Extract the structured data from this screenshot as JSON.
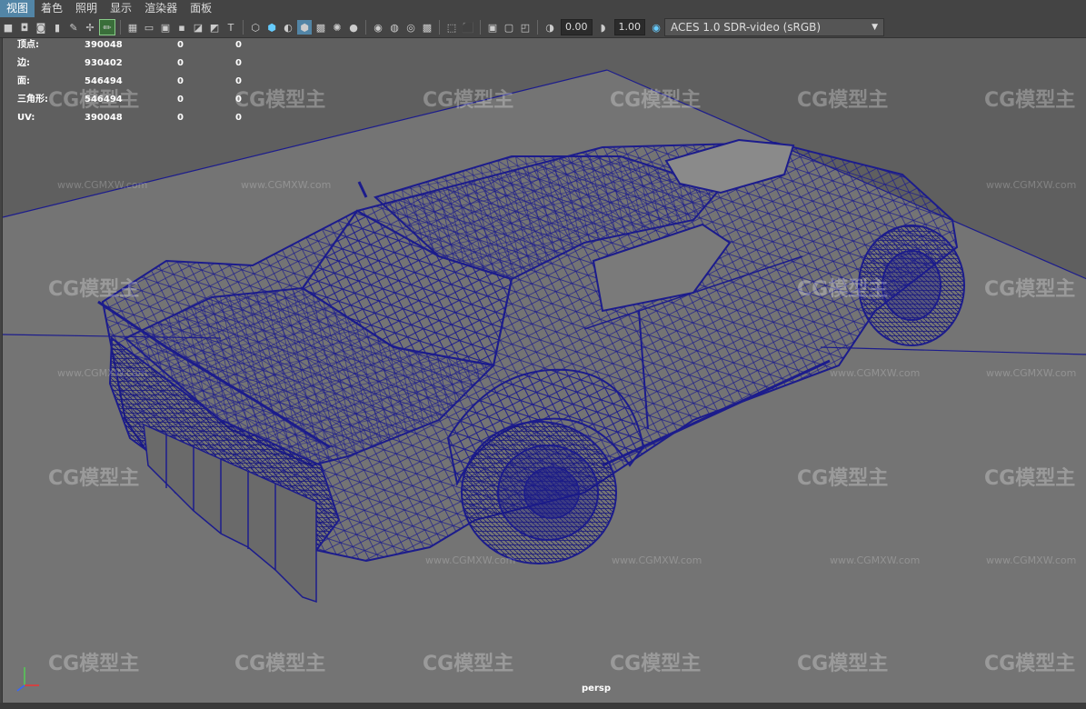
{
  "menu": {
    "items": [
      {
        "label": "视图",
        "active": true
      },
      {
        "label": "着色",
        "active": false
      },
      {
        "label": "照明",
        "active": false
      },
      {
        "label": "显示",
        "active": false
      },
      {
        "label": "渲染器",
        "active": false
      },
      {
        "label": "面板",
        "active": false
      }
    ]
  },
  "toolbar": {
    "exposure_value": "0.00",
    "gamma_value": "1.00",
    "color_space": "ACES 1.0 SDR-video (sRGB)"
  },
  "hud": {
    "rows": [
      {
        "label": "顶点:",
        "value": "390048",
        "sel": "0",
        "comp": "0"
      },
      {
        "label": "边:",
        "value": "930402",
        "sel": "0",
        "comp": "0"
      },
      {
        "label": "面:",
        "value": "546494",
        "sel": "0",
        "comp": "0"
      },
      {
        "label": "三角形:",
        "value": "546494",
        "sel": "0",
        "comp": "0"
      },
      {
        "label": "UV:",
        "value": "390048",
        "sel": "0",
        "comp": "0"
      }
    ]
  },
  "viewport": {
    "camera": "persp",
    "wireframe_color": "#1c1c8c",
    "background_color": "#7a7a7a"
  },
  "watermark": {
    "logo": "CG模型主",
    "url": "www.CGMXW.com"
  }
}
